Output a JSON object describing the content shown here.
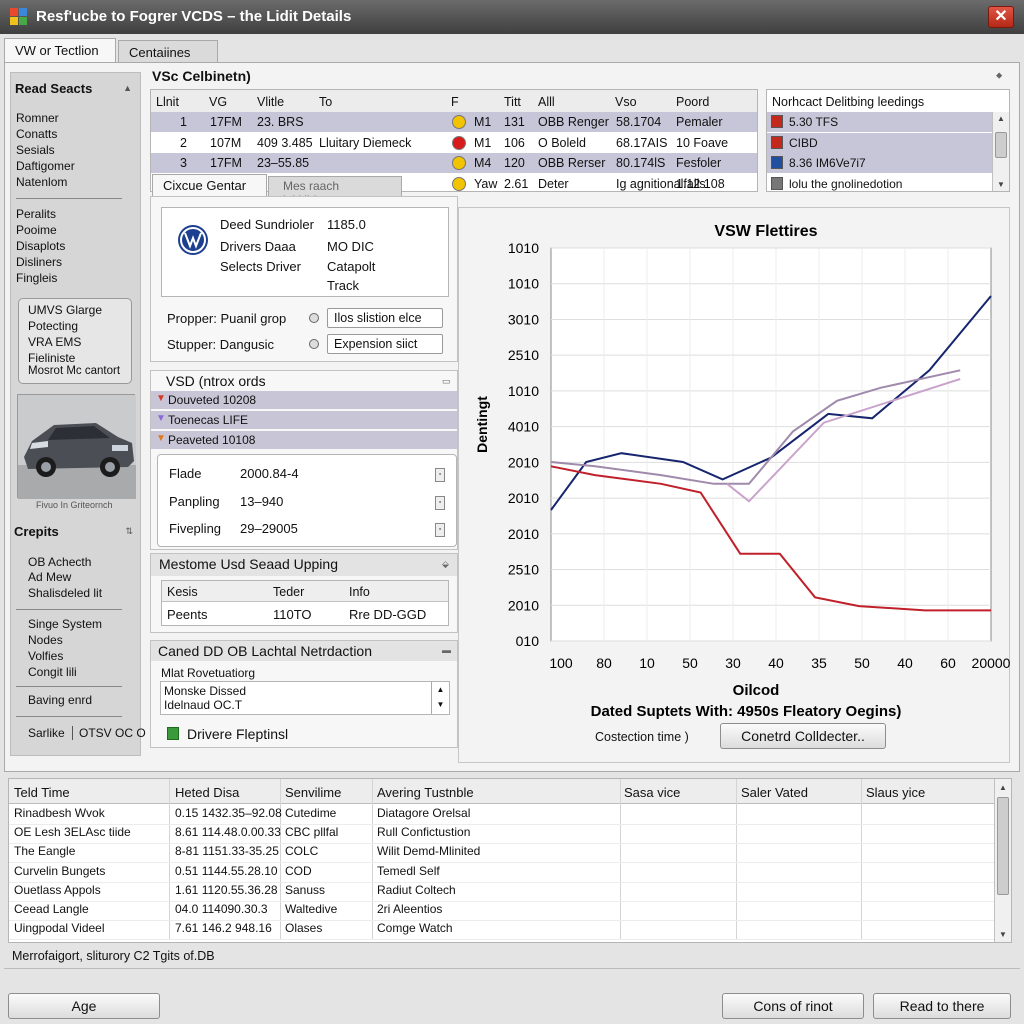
{
  "window": {
    "title": "Resf'ucbe to Fogrer VCDS – the Lidit Details",
    "close_glyph": "✕"
  },
  "tabs": [
    "VW or Tectlion",
    "Centaiines"
  ],
  "sidebar": {
    "read_header": "Read Seacts",
    "group1": [
      "Romner",
      "Conatts",
      "Sesials",
      "Daftigomer",
      "Natenlom"
    ],
    "group2": [
      "Peralits",
      "Pooime",
      "Disaplots",
      "Disliners",
      "Fingleis"
    ],
    "box_items": [
      "UMVS Glarge",
      "Potecting",
      "VRA EMS",
      "Fieliniste",
      "Mosrot Mc cantort"
    ],
    "car_caption": "Fivuo In Griteornch",
    "crepts_header": "Crepits",
    "group3": [
      "OB Achecth",
      "Ad Mew",
      "Shalisdeled lit"
    ],
    "group4": [
      "Singe System",
      "Nodes",
      "Volfies",
      "Congit lili"
    ],
    "group5": [
      "Baving enrd"
    ],
    "footer_left": "Sarlike",
    "footer_right": "OTSV OC O"
  },
  "vsc": {
    "title": "VSc Celbinetn)",
    "columns": [
      "Llnit",
      "VG",
      "Vlitle",
      "To",
      "F",
      "Titt",
      "Alll",
      "Vso",
      "Poord"
    ],
    "rows": [
      {
        "n": "1",
        "vg": "17FM",
        "title": "23. BRS",
        "to": "",
        "dot": "#f2c300",
        "f": "M1",
        "t": "131",
        "a": "OBB Renger",
        "v": "58.1704",
        "p": "Pemaler",
        "sel": true
      },
      {
        "n": "2",
        "vg": "107M",
        "title": "409 3.485",
        "to": "Lluitary Diemeck",
        "dot": "#d81a1a",
        "f": "M1",
        "t": "106",
        "a": "O Boleld",
        "v": "68.17AIS",
        "p": "10 Foave",
        "sel": false
      },
      {
        "n": "3",
        "vg": "17FM",
        "title": "23–55.85",
        "to": "",
        "dot": "#f2c300",
        "f": "M4",
        "t": "120",
        "a": "OBB Rerser",
        "v": "80.174lS",
        "p": "Fesfoler",
        "sel": true
      },
      {
        "n": "",
        "vg": "",
        "title": "",
        "to": "",
        "dot": "#f2c300",
        "f": "Yaw",
        "t": "2.61",
        "a": "Deter",
        "v": "Ig agnitionalfalls",
        "p": "1.12 108",
        "sel": false
      }
    ]
  },
  "readings": {
    "title": "Norhcact Delitbing leedings",
    "items": [
      {
        "icon_color": "#c4281c",
        "text": "5.30 TFS",
        "sel": true
      },
      {
        "icon_color": "#c4281c",
        "text": "CIBD",
        "sel": true
      },
      {
        "icon_color": "#1f4f9e",
        "text": "8.36 IM6Ve7i7",
        "sel": true
      },
      {
        "icon_color": "#777777",
        "text": "lolu the gnolinedotion",
        "sel": false
      }
    ]
  },
  "subtabs": [
    "Cixcue Gentar",
    "Mes raach laltitildes"
  ],
  "info": {
    "labels": [
      "Deed Sundrioler",
      "Drivers Daaa",
      "Selects Driver"
    ],
    "values": [
      "1185.0",
      "MO DIC",
      "Catapolt",
      "Track"
    ],
    "prop_label": "Propper: Puanil grop",
    "prop_value": "Ilos slistion elce",
    "stup_label": "Stupper: Dangusic",
    "stup_value": "Expension siict"
  },
  "vsd": {
    "title": "VSD (ntrox ords",
    "items": [
      {
        "text": "Douveted 10208",
        "arrow_color": "#d43a2a"
      },
      {
        "text": "Toenecas LIFE",
        "arrow_color": "#8a6ad8"
      },
      {
        "text": "Peaveted 10108",
        "arrow_color": "#e07a20"
      }
    ],
    "fields": [
      {
        "label": "Flade",
        "value": "2000.84-4"
      },
      {
        "label": "Panpling",
        "value": "13–940"
      },
      {
        "label": "Fivepling",
        "value": "29–29005"
      }
    ]
  },
  "mestome": {
    "title": "Mestome Usd Seaad Upping",
    "columns": [
      "Kesis",
      "Teder",
      "Info"
    ],
    "row": [
      "Peents",
      "110TO",
      "Rre DD-GGD"
    ]
  },
  "caned": {
    "title": "Caned DD OB Lachtal Netrdaction",
    "sublabel": "Mlat Rovetuatiorg",
    "select_lines": [
      "Monske Dissed",
      "Idelnaud OC.T"
    ],
    "checkbox_label": "Drivere Fleptinsl"
  },
  "chart_data": {
    "type": "line",
    "title": "VSW Flettires",
    "ylabel": "Dentingt",
    "xlabel": "Oilcod",
    "subtitle": "Dated Suptets With: 4950s Fleatory Oegins)",
    "x_tick_labels": [
      "100",
      "80",
      "10",
      "50",
      "30",
      "40",
      "35",
      "50",
      "40",
      "60",
      "20000"
    ],
    "y_tick_labels": [
      "1010",
      "1010",
      "3010",
      "2510",
      "1010",
      "4010",
      "2010",
      "2010",
      "2010",
      "2510",
      "2010",
      "010"
    ],
    "grid": true,
    "series": [
      {
        "color": "#16256e",
        "values": [
          -0.5,
          0.05,
          0.15,
          0.05,
          -0.15,
          0.1,
          0.6,
          0.55,
          1.1,
          1.95
        ]
      },
      {
        "color": "#c0202a",
        "values": [
          0.0,
          -0.1,
          -0.2,
          -0.3,
          -1.0,
          -1.0,
          -1.5,
          -1.6,
          -1.65,
          -1.65
        ]
      },
      {
        "color": "#a08aac",
        "values": [
          0.05,
          0.0,
          -0.1,
          -0.2,
          -0.2,
          0.4,
          0.75,
          0.9,
          1.1
        ]
      },
      {
        "color": "#c9a3cb",
        "values": [
          -0.2,
          -0.4,
          0.5,
          1.0
        ]
      }
    ],
    "series_x": [
      [
        0,
        0.08,
        0.16,
        0.3,
        0.39,
        0.5,
        0.63,
        0.73,
        0.86,
        1.0
      ],
      [
        0,
        0.1,
        0.25,
        0.34,
        0.43,
        0.52,
        0.6,
        0.7,
        0.85,
        1.0
      ],
      [
        0,
        0.1,
        0.25,
        0.37,
        0.45,
        0.55,
        0.65,
        0.75,
        0.93
      ],
      [
        0.4,
        0.45,
        0.62,
        0.93
      ]
    ],
    "convection_label": "Costection time )",
    "button_label": "Conetrd Colldecter.."
  },
  "bottom_table": {
    "columns": [
      "Teld Time",
      "Heted Disa",
      "Senvilime",
      "Avering Tustnble",
      "Sasa vice",
      "Saler Vated",
      "Slaus yice"
    ],
    "rows": [
      [
        "Rinadbesh Wvok",
        "0.15 1432.35–92.08",
        "Cutedime",
        "Diatagore Orelsal",
        "",
        "",
        ""
      ],
      [
        "OE Lesh 3ELAsc tiide",
        "8.61 114.48.0.00.33",
        "CBC pllfal",
        "Rull Confictustion",
        "",
        "",
        ""
      ],
      [
        "The Eangle",
        "8-81 1151.33-35.25",
        "COLC",
        "Wilit Demd-Mlinited",
        "",
        "",
        ""
      ],
      [
        "Curvelin Bungets",
        "0.51 1144.55.28.10",
        "COD",
        "Temedl Self",
        "",
        "",
        ""
      ],
      [
        "Ouetlass Appols",
        "1.61 1120.55.36.28",
        "Sanuss",
        "Radiut Coltech",
        "",
        "",
        ""
      ],
      [
        "Ceead Langle",
        "04.0 114090.30.3",
        "Waltedive",
        "2ri Aleentios",
        "",
        "",
        ""
      ],
      [
        "Uingpodal Videel",
        "7.61 146.2 948.16",
        "Olases",
        "Comge Watch",
        "",
        "",
        ""
      ]
    ]
  },
  "status": "Merrofaigort, sliturory C2 Tgits of.DB",
  "buttons": {
    "age": "Age",
    "cons": "Cons of rinot",
    "read": "Read to there"
  }
}
